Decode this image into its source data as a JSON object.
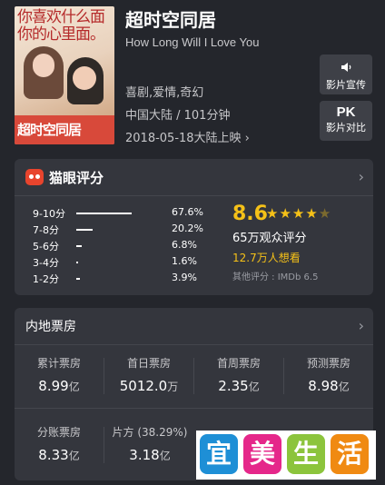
{
  "movie": {
    "title": "超时空同居",
    "original_title": "How Long Will I Love You",
    "genres": "喜剧,爱情,奇幻",
    "region_duration": "中国大陆 / 101分钟",
    "release": "2018-05-18大陆上映",
    "release_chevron": "›"
  },
  "poster": {
    "top_text": "你喜欢什么面\n你的心里面。",
    "bottom_text": "超时空同居"
  },
  "side_buttons": {
    "trailer_label": "影片宣传",
    "pk_icon_text": "PK",
    "compare_label": "影片对比"
  },
  "rating": {
    "section_title": "猫眼评分",
    "chevron": "›",
    "distribution": [
      {
        "label": "9-10分",
        "percent_text": "67.6%",
        "fraction": 0.676
      },
      {
        "label": "7-8分",
        "percent_text": "20.2%",
        "fraction": 0.202
      },
      {
        "label": "5-6分",
        "percent_text": "6.8%",
        "fraction": 0.068
      },
      {
        "label": "3-4分",
        "percent_text": "1.6%",
        "fraction": 0.016
      },
      {
        "label": "1-2分",
        "percent_text": "3.9%",
        "fraction": 0.039
      }
    ],
    "score": "8.6",
    "stars_value": 4.5,
    "count_text": "65万观众评分",
    "want_text": "12.7万人想看",
    "other_text": "其他评分 : IMDb 6.5"
  },
  "box_office": {
    "section_title": "内地票房",
    "chevron": "›",
    "stats": [
      {
        "label": "累计票房",
        "value": "8.99",
        "unit": "亿"
      },
      {
        "label": "首日票房",
        "value": "5012.0",
        "unit": "万"
      },
      {
        "label": "首周票房",
        "value": "2.35",
        "unit": "亿"
      },
      {
        "label": "预测票房",
        "value": "8.98",
        "unit": "亿"
      }
    ],
    "split": {
      "label": "分账票房",
      "value": "8.33",
      "unit": "亿"
    },
    "producer": {
      "label": "片方 (38.29%)",
      "value": "3.18",
      "unit": "亿"
    }
  },
  "watermark": {
    "chars": [
      "宜",
      "美",
      "生",
      "活"
    ],
    "colors": [
      "#1e8fd6",
      "#e5278a",
      "#8cc43c",
      "#f08a12"
    ]
  }
}
